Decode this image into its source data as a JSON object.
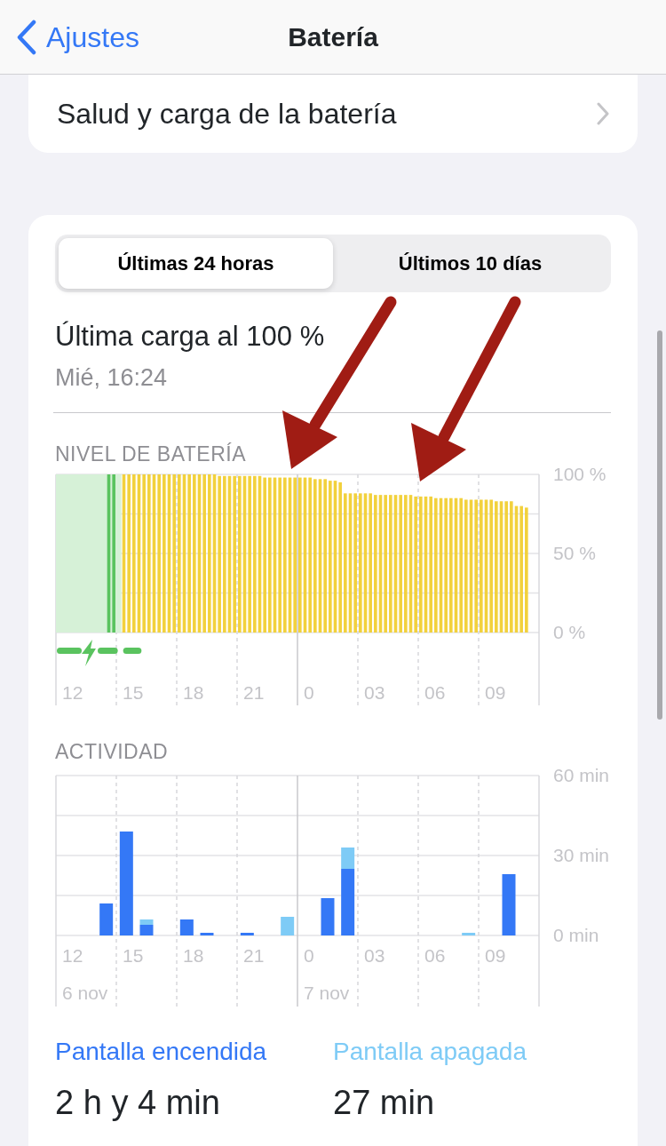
{
  "nav": {
    "back": "Ajustes",
    "title": "Batería"
  },
  "health_row": {
    "label": "Salud y carga de la batería"
  },
  "segments": [
    {
      "label": "Últimas 24 horas",
      "selected": true
    },
    {
      "label": "Últimos 10 días",
      "selected": false
    }
  ],
  "last_charge": {
    "title": "Última carga al 100 %",
    "date": "Mié, 16:24"
  },
  "battery_chart": {
    "title": "NIVEL DE BATERÍA",
    "hour_labels": [
      "12",
      "15",
      "18",
      "21",
      "0",
      "03",
      "06",
      "09"
    ],
    "chart_data": {
      "type": "bar",
      "ylim": [
        0,
        100
      ],
      "yticks": [
        {
          "value": 100,
          "label": "100 %"
        },
        {
          "value": 50,
          "label": "50 %"
        },
        {
          "value": 0,
          "label": "0 %"
        }
      ],
      "series": [
        {
          "color": "#5ac35f",
          "values": [
            null,
            null,
            null,
            null,
            null,
            null,
            null,
            null,
            null,
            null,
            100,
            100,
            null,
            null,
            null,
            null,
            null,
            null,
            null,
            null,
            null,
            null,
            null,
            null,
            null,
            null,
            null,
            null,
            null,
            null,
            null,
            null,
            null,
            null,
            null,
            null,
            null,
            null,
            null,
            null,
            null,
            null,
            null,
            null,
            null,
            null,
            null,
            null,
            null,
            null,
            null,
            null,
            null,
            null,
            null,
            null,
            null,
            null,
            null,
            null,
            null,
            null,
            null,
            null,
            null,
            null,
            null,
            null,
            null,
            null,
            null,
            null,
            null,
            null,
            null,
            null,
            null,
            null,
            null,
            null,
            null,
            null,
            null,
            null,
            null,
            null,
            null,
            null,
            null,
            null,
            null,
            null,
            null,
            null,
            null,
            null
          ]
        },
        {
          "color": "#f2d13c",
          "values": [
            null,
            null,
            null,
            null,
            null,
            null,
            null,
            null,
            null,
            null,
            null,
            null,
            null,
            100,
            100,
            100,
            100,
            100,
            100,
            100,
            100,
            100,
            100,
            100,
            100,
            100,
            100,
            100,
            100,
            100,
            100,
            100,
            99,
            99,
            99,
            99,
            99,
            99,
            99,
            99,
            99,
            98,
            98,
            98,
            98,
            98,
            98,
            98,
            98,
            98,
            98,
            97,
            97,
            97,
            96,
            96,
            95,
            88,
            88,
            88,
            88,
            88,
            88,
            87,
            87,
            87,
            87,
            87,
            87,
            87,
            87,
            86,
            86,
            86,
            86,
            85,
            85,
            85,
            85,
            85,
            85,
            84,
            84,
            84,
            84,
            84,
            84,
            83,
            83,
            83,
            83,
            80,
            80,
            79,
            null,
            null
          ]
        }
      ]
    }
  },
  "activity_chart": {
    "title": "ACTIVIDAD",
    "hour_labels": [
      "12",
      "15",
      "18",
      "21",
      "0",
      "03",
      "06",
      "09"
    ],
    "date_labels": [
      "6 nov",
      "7 nov"
    ],
    "chart_data": {
      "type": "bar",
      "stacked": true,
      "ylim": [
        0,
        60
      ],
      "yticks": [
        {
          "value": 60,
          "label": "60 min"
        },
        {
          "value": 30,
          "label": "30 min"
        },
        {
          "value": 0,
          "label": "0 min"
        }
      ],
      "series": [
        {
          "name": "Pantalla encendida",
          "color": "#3478f6",
          "values": [
            0,
            0,
            12,
            39,
            4,
            0,
            6,
            1,
            0,
            1,
            0,
            0,
            0,
            14,
            25,
            0,
            0,
            0,
            0,
            0,
            0,
            0,
            23,
            0
          ]
        },
        {
          "name": "Pantalla apagada",
          "color": "#7ecbf6",
          "values": [
            0,
            0,
            0,
            0,
            2,
            0,
            0,
            0,
            0,
            0,
            0,
            7,
            0,
            0,
            8,
            0,
            0,
            0,
            0,
            0,
            1,
            0,
            0,
            0
          ]
        }
      ]
    }
  },
  "totals": [
    {
      "value": "2 h y 4 min"
    },
    {
      "value": "27 min"
    }
  ]
}
